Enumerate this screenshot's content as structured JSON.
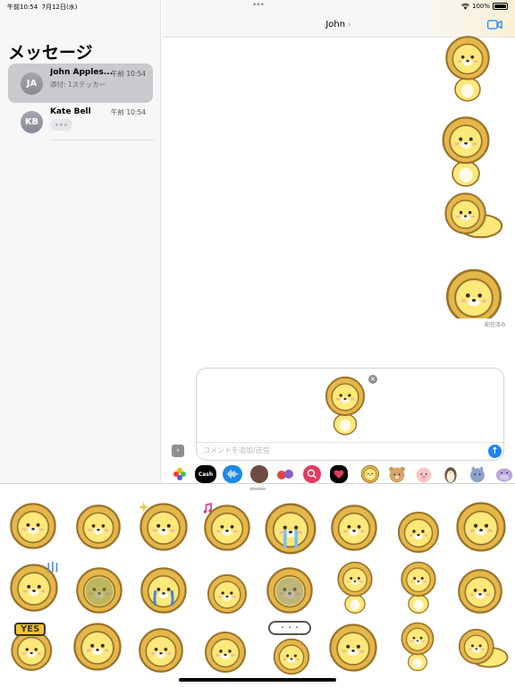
{
  "status_bar": {
    "time": "午前10:54",
    "date": "7月12日(水)",
    "battery": "100%"
  },
  "sidebar": {
    "title": "メッセージ",
    "conversations": [
      {
        "initials": "JA",
        "name": "John Apples...",
        "time": "午前 10:54",
        "preview": "添付: 1ステッカー",
        "selected": true
      },
      {
        "initials": "KB",
        "name": "Kate Bell",
        "time": "午前 10:54",
        "preview": "typing-indicator",
        "selected": false
      }
    ]
  },
  "conversation": {
    "title": "John",
    "delivered": "配信済み"
  },
  "compose": {
    "placeholder": "コメントを追加/送信",
    "attached": "lion-sticker"
  },
  "app_drawer": {
    "items": [
      {
        "name": "photos-app-icon",
        "label": "",
        "bg": "#ffffff"
      },
      {
        "name": "apple-cash-app-icon",
        "label": "Cash",
        "bg": "#000000"
      },
      {
        "name": "audio-message-app-icon",
        "label": "",
        "bg": "#1e88e5"
      },
      {
        "name": "memoji-app-icon",
        "label": "",
        "bg": "#6d4c41"
      },
      {
        "name": "animoji-app-icon",
        "label": "",
        "bg": "#ffffff"
      },
      {
        "name": "search-images-app-icon",
        "label": "",
        "bg": "#e53960"
      },
      {
        "name": "digital-touch-app-icon",
        "label": "",
        "bg": "#000000"
      },
      {
        "name": "lion-sticker-app-icon",
        "label": "",
        "bg": "#ffffff"
      },
      {
        "name": "bear-sticker-app-icon",
        "label": "",
        "bg": "#ffffff"
      },
      {
        "name": "pig-sticker-app-icon",
        "label": "",
        "bg": "#ffffff"
      },
      {
        "name": "penguin-sticker-app-icon",
        "label": "",
        "bg": "#ffffff"
      },
      {
        "name": "cat-sticker-app-icon",
        "label": "",
        "bg": "#ffffff"
      },
      {
        "name": "hippo-sticker-app-icon",
        "label": "",
        "bg": "#ffffff"
      }
    ]
  },
  "keyboard": {
    "sticker_text": {
      "yes": "YES",
      "dots": "・・・"
    },
    "stickers": [
      "lion-dizzy",
      "lion-smile",
      "lion-sparkle",
      "lion-music",
      "lion-crying",
      "lion-swirl",
      "lion-sweat",
      "lion-ok",
      "lion-gloom",
      "lion-dark-face",
      "lion-tears",
      "lion-happy",
      "lion-shadow",
      "lion-standing",
      "lion-standing-2",
      "lion-smile-2",
      "lion-yes",
      "lion-wave",
      "lion-peek",
      "lion-grin",
      "lion-speech",
      "lion-cub",
      "lion-walk",
      "lion-lying"
    ]
  },
  "colors": {
    "accent": "#1a84f8",
    "mane": "#e2b84a",
    "face": "#fde87a",
    "outline": "#a0762c"
  }
}
